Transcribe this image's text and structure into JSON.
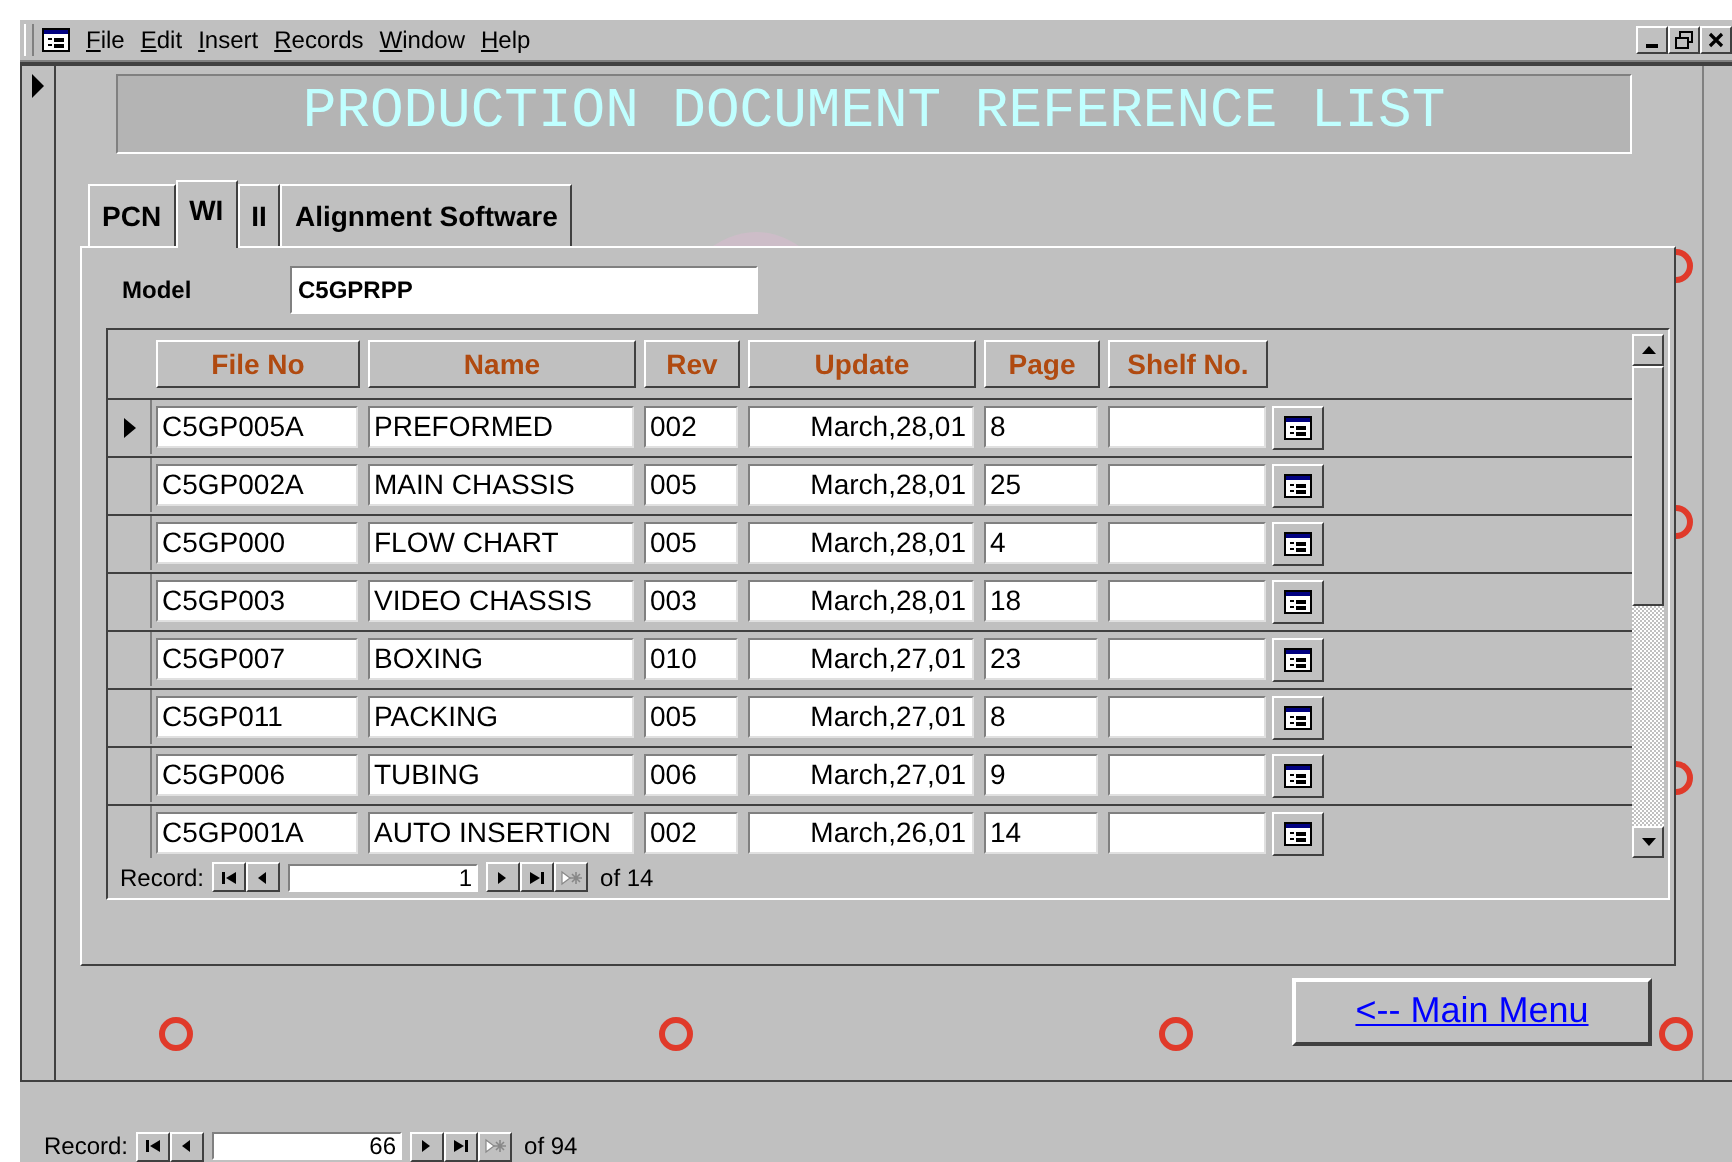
{
  "menu": [
    "File",
    "Edit",
    "Insert",
    "Records",
    "Window",
    "Help"
  ],
  "title": "PRODUCTION DOCUMENT REFERENCE LIST",
  "tabs": [
    {
      "label": "PCN",
      "selected": false
    },
    {
      "label": "WI",
      "selected": true
    },
    {
      "label": "II",
      "selected": false
    },
    {
      "label": "Alignment Software",
      "selected": false
    }
  ],
  "model": {
    "label": "Model",
    "value": "C5GPRPP"
  },
  "columns": [
    "File No",
    "Name",
    "Rev",
    "Update",
    "Page",
    "Shelf No."
  ],
  "rows": [
    {
      "file_no": "C5GP005A",
      "name": "PREFORMED",
      "rev": "002",
      "update": "March,28,01",
      "page": "8",
      "current": true
    },
    {
      "file_no": "C5GP002A",
      "name": "MAIN CHASSIS",
      "rev": "005",
      "update": "March,28,01",
      "page": "25",
      "current": false
    },
    {
      "file_no": "C5GP000",
      "name": "FLOW CHART",
      "rev": "005",
      "update": "March,28,01",
      "page": "4",
      "current": false
    },
    {
      "file_no": "C5GP003",
      "name": "VIDEO CHASSIS",
      "rev": "003",
      "update": "March,28,01",
      "page": "18",
      "current": false
    },
    {
      "file_no": "C5GP007",
      "name": "BOXING",
      "rev": "010",
      "update": "March,27,01",
      "page": "23",
      "current": false
    },
    {
      "file_no": "C5GP011",
      "name": "PACKING",
      "rev": "005",
      "update": "March,27,01",
      "page": "8",
      "current": false
    },
    {
      "file_no": "C5GP006",
      "name": "TUBING",
      "rev": "006",
      "update": "March,27,01",
      "page": "9",
      "current": false
    },
    {
      "file_no": "C5GP001A",
      "name": "AUTO INSERTION",
      "rev": "002",
      "update": "March,26,01",
      "page": "14",
      "current": false
    }
  ],
  "subform_nav": {
    "label": "Record:",
    "current": "1",
    "total": "of 14"
  },
  "main_menu_link": "<-- Main Menu",
  "record_nav": {
    "label": "Record:",
    "current": "66",
    "total": "of 94"
  }
}
